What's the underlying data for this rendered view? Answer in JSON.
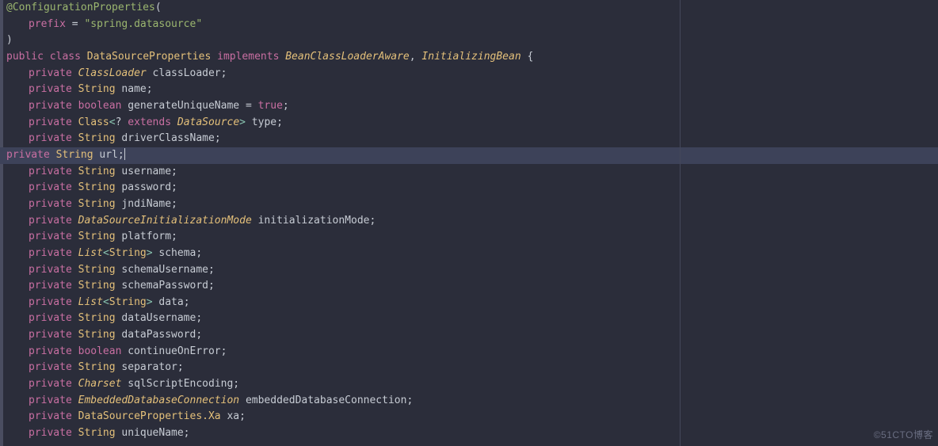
{
  "editor": {
    "theme": "dark",
    "caret_line_index": 9,
    "right_split_visible": true,
    "lines": [
      {
        "indent": 0,
        "tokens": [
          {
            "c": "anno",
            "t": "@ConfigurationProperties"
          },
          {
            "c": "plain",
            "t": "("
          }
        ]
      },
      {
        "indent": 1,
        "tokens": [
          {
            "c": "key",
            "t": "prefix"
          },
          {
            "c": "plain",
            "t": " = "
          },
          {
            "c": "str",
            "t": "\"spring.datasource\""
          }
        ]
      },
      {
        "indent": 0,
        "tokens": [
          {
            "c": "plain",
            "t": ")"
          }
        ]
      },
      {
        "indent": 0,
        "tokens": [
          {
            "c": "key",
            "t": "public class "
          },
          {
            "c": "classn",
            "t": "DataSourceProperties "
          },
          {
            "c": "key",
            "t": "implements "
          },
          {
            "c": "class",
            "t": "BeanClassLoaderAware"
          },
          {
            "c": "plain",
            "t": ", "
          },
          {
            "c": "class",
            "t": "InitializingBean"
          },
          {
            "c": "plain",
            "t": " {"
          }
        ]
      },
      {
        "indent": 1,
        "tokens": [
          {
            "c": "key",
            "t": "private "
          },
          {
            "c": "class",
            "t": "ClassLoader"
          },
          {
            "c": "plain",
            "t": " classLoader;"
          }
        ]
      },
      {
        "indent": 1,
        "tokens": [
          {
            "c": "key",
            "t": "private "
          },
          {
            "c": "classn",
            "t": "String"
          },
          {
            "c": "plain",
            "t": " name;"
          }
        ]
      },
      {
        "indent": 1,
        "tokens": [
          {
            "c": "key",
            "t": "private boolean"
          },
          {
            "c": "plain",
            "t": " generateUniqueName = "
          },
          {
            "c": "bool",
            "t": "true"
          },
          {
            "c": "plain",
            "t": ";"
          }
        ]
      },
      {
        "indent": 1,
        "tokens": [
          {
            "c": "key",
            "t": "private "
          },
          {
            "c": "classn",
            "t": "Class"
          },
          {
            "c": "angle",
            "t": "<"
          },
          {
            "c": "plain",
            "t": "? "
          },
          {
            "c": "key",
            "t": "extends "
          },
          {
            "c": "class",
            "t": "DataSource"
          },
          {
            "c": "angle",
            "t": ">"
          },
          {
            "c": "plain",
            "t": " type;"
          }
        ]
      },
      {
        "indent": 1,
        "tokens": [
          {
            "c": "key",
            "t": "private "
          },
          {
            "c": "classn",
            "t": "String"
          },
          {
            "c": "plain",
            "t": " driverClassName;"
          }
        ]
      },
      {
        "indent": 1,
        "highlight": true,
        "caret_after": true,
        "tokens": [
          {
            "c": "key",
            "t": "private "
          },
          {
            "c": "classn",
            "t": "String"
          },
          {
            "c": "plain",
            "t": " url;"
          }
        ]
      },
      {
        "indent": 1,
        "tokens": [
          {
            "c": "key",
            "t": "private "
          },
          {
            "c": "classn",
            "t": "String"
          },
          {
            "c": "plain",
            "t": " username;"
          }
        ]
      },
      {
        "indent": 1,
        "tokens": [
          {
            "c": "key",
            "t": "private "
          },
          {
            "c": "classn",
            "t": "String"
          },
          {
            "c": "plain",
            "t": " password;"
          }
        ]
      },
      {
        "indent": 1,
        "tokens": [
          {
            "c": "key",
            "t": "private "
          },
          {
            "c": "classn",
            "t": "String"
          },
          {
            "c": "plain",
            "t": " jndiName;"
          }
        ]
      },
      {
        "indent": 1,
        "tokens": [
          {
            "c": "key",
            "t": "private "
          },
          {
            "c": "class",
            "t": "DataSourceInitializationMode"
          },
          {
            "c": "plain",
            "t": " initializationMode;"
          }
        ]
      },
      {
        "indent": 1,
        "tokens": [
          {
            "c": "key",
            "t": "private "
          },
          {
            "c": "classn",
            "t": "String"
          },
          {
            "c": "plain",
            "t": " platform;"
          }
        ]
      },
      {
        "indent": 1,
        "tokens": [
          {
            "c": "key",
            "t": "private "
          },
          {
            "c": "class",
            "t": "List"
          },
          {
            "c": "angle",
            "t": "<"
          },
          {
            "c": "classn",
            "t": "String"
          },
          {
            "c": "angle",
            "t": ">"
          },
          {
            "c": "plain",
            "t": " schema;"
          }
        ]
      },
      {
        "indent": 1,
        "tokens": [
          {
            "c": "key",
            "t": "private "
          },
          {
            "c": "classn",
            "t": "String"
          },
          {
            "c": "plain",
            "t": " schemaUsername;"
          }
        ]
      },
      {
        "indent": 1,
        "tokens": [
          {
            "c": "key",
            "t": "private "
          },
          {
            "c": "classn",
            "t": "String"
          },
          {
            "c": "plain",
            "t": " schemaPassword;"
          }
        ]
      },
      {
        "indent": 1,
        "tokens": [
          {
            "c": "key",
            "t": "private "
          },
          {
            "c": "class",
            "t": "List"
          },
          {
            "c": "angle",
            "t": "<"
          },
          {
            "c": "classn",
            "t": "String"
          },
          {
            "c": "angle",
            "t": ">"
          },
          {
            "c": "plain",
            "t": " data;"
          }
        ]
      },
      {
        "indent": 1,
        "tokens": [
          {
            "c": "key",
            "t": "private "
          },
          {
            "c": "classn",
            "t": "String"
          },
          {
            "c": "plain",
            "t": " dataUsername;"
          }
        ]
      },
      {
        "indent": 1,
        "tokens": [
          {
            "c": "key",
            "t": "private "
          },
          {
            "c": "classn",
            "t": "String"
          },
          {
            "c": "plain",
            "t": " dataPassword;"
          }
        ]
      },
      {
        "indent": 1,
        "tokens": [
          {
            "c": "key",
            "t": "private boolean"
          },
          {
            "c": "plain",
            "t": " continueOnError;"
          }
        ]
      },
      {
        "indent": 1,
        "tokens": [
          {
            "c": "key",
            "t": "private "
          },
          {
            "c": "classn",
            "t": "String"
          },
          {
            "c": "plain",
            "t": " separator;"
          }
        ]
      },
      {
        "indent": 1,
        "tokens": [
          {
            "c": "key",
            "t": "private "
          },
          {
            "c": "class",
            "t": "Charset"
          },
          {
            "c": "plain",
            "t": " sqlScriptEncoding;"
          }
        ]
      },
      {
        "indent": 1,
        "tokens": [
          {
            "c": "key",
            "t": "private "
          },
          {
            "c": "class",
            "t": "EmbeddedDatabaseConnection"
          },
          {
            "c": "plain",
            "t": " embeddedDatabaseConnection;"
          }
        ]
      },
      {
        "indent": 1,
        "tokens": [
          {
            "c": "key",
            "t": "private "
          },
          {
            "c": "classn",
            "t": "DataSourceProperties.Xa"
          },
          {
            "c": "plain",
            "t": " xa;"
          }
        ]
      },
      {
        "indent": 1,
        "tokens": [
          {
            "c": "key",
            "t": "private "
          },
          {
            "c": "classn",
            "t": "String"
          },
          {
            "c": "plain",
            "t": " uniqueName;"
          }
        ]
      }
    ]
  },
  "watermark": "©51CTO博客"
}
